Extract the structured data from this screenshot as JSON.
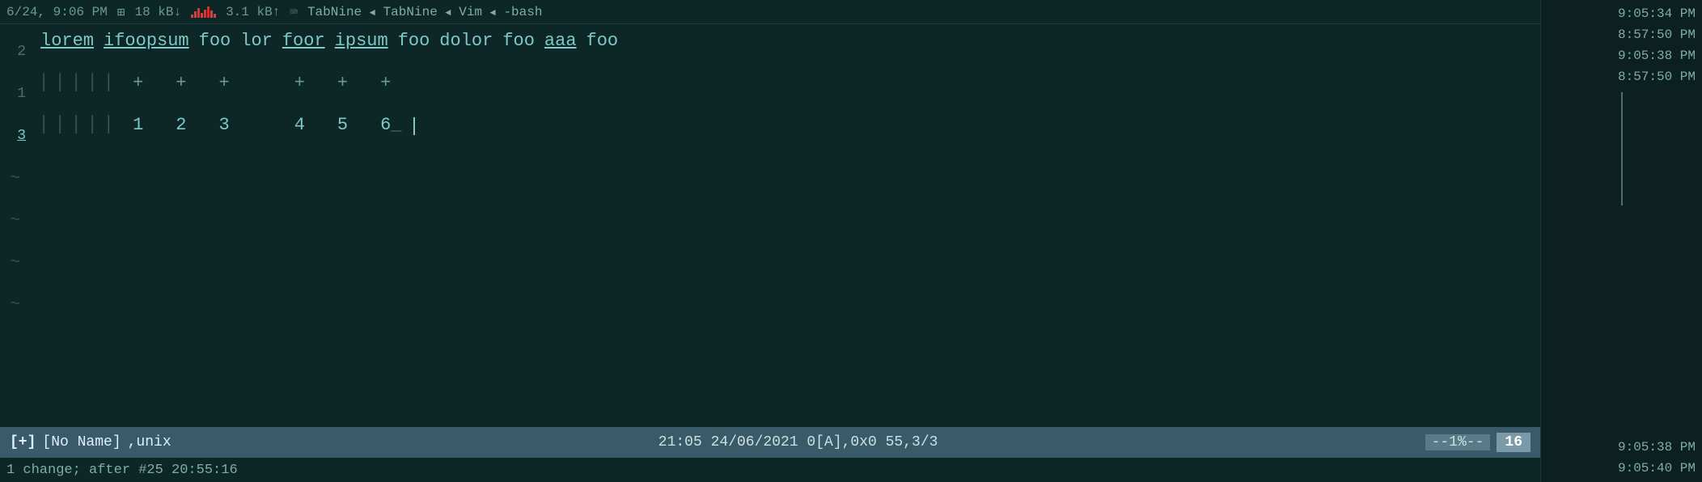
{
  "statusbar": {
    "datetime": "6/24, 9:06 PM",
    "net_down": "18 kB↓",
    "net_up": "3.1 kB↑",
    "tabnine": "TabNine",
    "vim": "Vim",
    "bash": "-bash",
    "arrow": "◄"
  },
  "editor": {
    "lines": [
      {
        "num": "2",
        "words": [
          "lorem",
          "ifoopsum",
          "foo",
          "lor",
          "foor",
          "ipsum",
          "foo",
          "dolor",
          "foo",
          "aaa",
          "foo"
        ],
        "underlined": [
          0,
          1,
          4,
          5,
          9
        ]
      },
      {
        "num": "1",
        "dividers": true,
        "plusses": [
          "+",
          "+",
          "+",
          "+",
          "+",
          "+"
        ]
      },
      {
        "num": "3",
        "numbers": [
          "1",
          "2",
          "3",
          "4",
          "5",
          "6_"
        ]
      }
    ],
    "tildes": [
      "~",
      "~",
      "~",
      "~"
    ]
  },
  "statusline": {
    "flag": "[+]",
    "name": "[No Name]",
    "format": ",unix",
    "info": "21:05  24/06/2021  0[A],0x0  55,3/3",
    "percent": "--1%--",
    "col": "16"
  },
  "cmdline": {
    "text": "1 change; after #25  20:55:16"
  },
  "sidebar": {
    "times": [
      "9:05:34 PM",
      "8:57:50 PM",
      "9:05:38 PM",
      "8:57:50 PM",
      "9:05:38 PM",
      "9:05:40 PM"
    ]
  }
}
